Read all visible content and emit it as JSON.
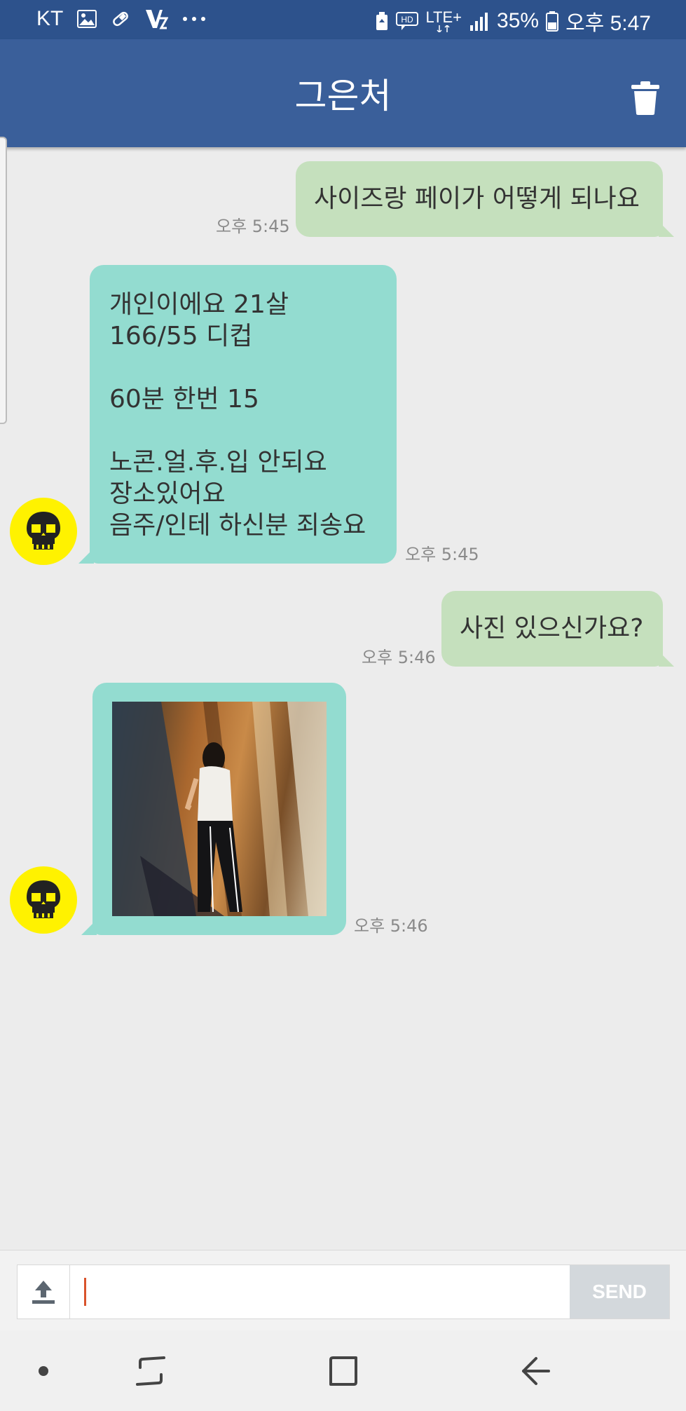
{
  "status_bar": {
    "carrier": "KT",
    "network": "LTE+",
    "hd_label": "HD",
    "battery": "35%",
    "time": "오후 5:47",
    "left_icons": [
      "image-icon",
      "pill-icon",
      "v-app-icon",
      "more-dots-icon"
    ],
    "right_icons": [
      "battery-saver-icon",
      "hd-voice-icon",
      "lte-icon",
      "signal-icon",
      "battery-icon"
    ]
  },
  "header": {
    "title": "그은처",
    "action_icon": "trash-icon"
  },
  "messages": [
    {
      "direction": "outgoing",
      "lines": [
        "사이즈랑 페이가 어떻게 되나요"
      ],
      "time": "오후 5:45"
    },
    {
      "direction": "incoming",
      "avatar_icon": "skull-icon",
      "lines": [
        "개인이에요 21살",
        "166/55 디컵",
        "",
        "60분 한번 15",
        "",
        "노콘.얼.후.입 안되요",
        "장소있어요",
        "음주/인테 하신분 죄송요"
      ],
      "time": "오후 5:45"
    },
    {
      "direction": "outgoing",
      "lines": [
        "사진 있으신가요?"
      ],
      "time": "오후 5:46"
    },
    {
      "direction": "incoming",
      "avatar_icon": "skull-icon",
      "type": "image",
      "time": "오후 5:46"
    }
  ],
  "composer": {
    "value": "",
    "placeholder": "",
    "upload_icon": "upload-icon",
    "send_label": "SEND"
  },
  "nav_bar": {
    "icons": [
      "dot-icon",
      "recents-icon",
      "home-icon",
      "back-icon"
    ]
  },
  "colors": {
    "status_bar": "#2d528c",
    "app_bar": "#3a5f9a",
    "outgoing_bubble": "#c5e0bd",
    "incoming_bubble": "#93dcd0",
    "avatar": "#fff200",
    "background": "#ececec",
    "caret": "#d9532c"
  }
}
